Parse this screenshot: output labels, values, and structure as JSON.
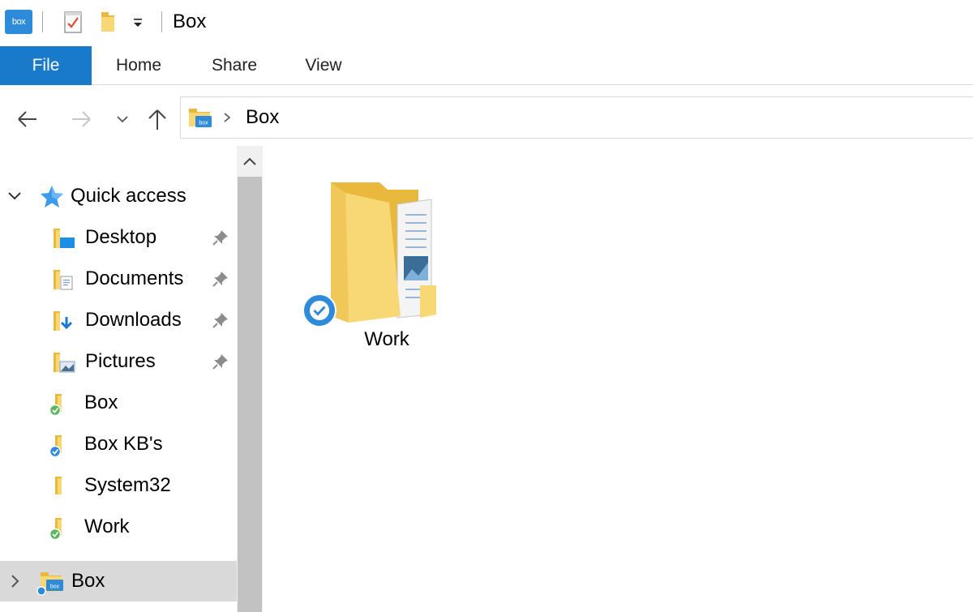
{
  "window": {
    "title": "Box",
    "app_logo_text": "box"
  },
  "ribbon": {
    "tabs": [
      {
        "label": "File",
        "active": true
      },
      {
        "label": "Home"
      },
      {
        "label": "Share"
      },
      {
        "label": "View"
      }
    ]
  },
  "address_bar": {
    "path": [
      "Box"
    ]
  },
  "nav_pane": {
    "quick_access": {
      "label": "Quick access",
      "expanded": true
    },
    "items": [
      {
        "label": "Desktop",
        "icon": "desktop-folder-icon",
        "pinned": true
      },
      {
        "label": "Documents",
        "icon": "documents-folder-icon",
        "pinned": true
      },
      {
        "label": "Downloads",
        "icon": "downloads-folder-icon",
        "pinned": true
      },
      {
        "label": "Pictures",
        "icon": "pictures-folder-icon",
        "pinned": true
      },
      {
        "label": "Box",
        "icon": "folder-synced-green-icon",
        "pinned": false
      },
      {
        "label": "Box KB's",
        "icon": "folder-synced-blue-icon",
        "pinned": false
      },
      {
        "label": "System32",
        "icon": "folder-icon",
        "pinned": false
      },
      {
        "label": "Work",
        "icon": "folder-synced-green-icon",
        "pinned": false
      }
    ],
    "box_root": {
      "label": "Box",
      "selected": true,
      "expanded": false
    }
  },
  "content": {
    "items": [
      {
        "label": "Work",
        "icon": "large-folder-icon",
        "status": "synced"
      }
    ]
  },
  "colors": {
    "accent": "#1979ca",
    "folder_yellow": "#f8d775",
    "folder_dark": "#e8b93c",
    "sync_green": "#5cb85c",
    "sync_blue": "#2e8bd9",
    "selection": "#d9d9d9"
  }
}
